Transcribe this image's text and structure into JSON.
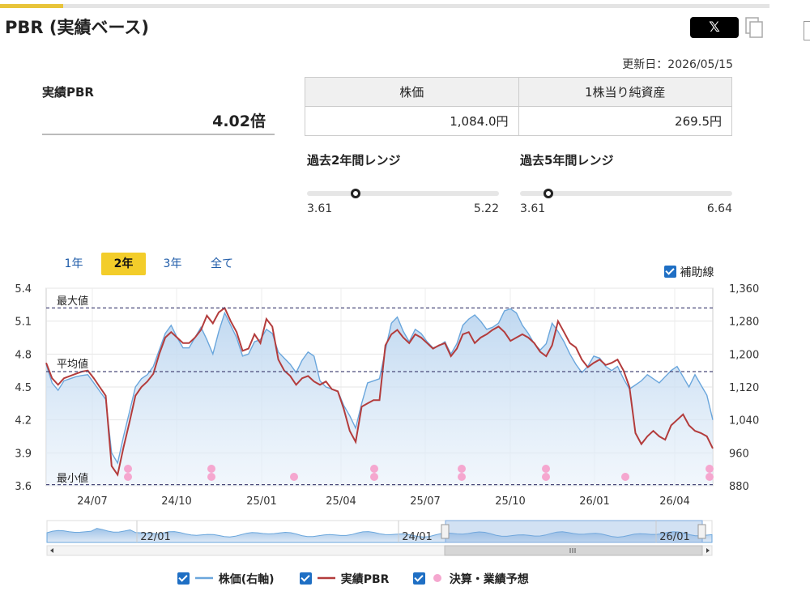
{
  "header": {
    "title": "PBR (実績ベース)",
    "share_label": "𝕏",
    "updated": "更新日：2026/05/15"
  },
  "pbr": {
    "label": "実績PBR",
    "value": "4.02倍"
  },
  "info_table": {
    "headers": [
      "株価",
      "1株当り純資産"
    ],
    "values": [
      "1,084.0円",
      "269.5円"
    ]
  },
  "ranges": [
    {
      "title": "過去2年間レンジ",
      "min": "3.61",
      "max": "5.22",
      "current": 4.02,
      "lo": 3.61,
      "hi": 5.22
    },
    {
      "title": "過去5年間レンジ",
      "min": "3.61",
      "max": "6.64",
      "current": 4.02,
      "lo": 3.61,
      "hi": 6.64
    }
  ],
  "tabs": [
    "1年",
    "2年",
    "3年",
    "全て"
  ],
  "active_tab": "2年",
  "aux_lines_label": "補助線",
  "legend": [
    "株価(右軸)",
    "実績PBR",
    "決算・業績予想"
  ],
  "colors": {
    "price": "#6aa6dc",
    "pbr": "#b33c3c",
    "event": "#f5a7cf",
    "accent": "#f3cd2a"
  },
  "chart_data": {
    "type": "line",
    "x_ticks": [
      "24/07",
      "24/10",
      "25/01",
      "25/04",
      "25/07",
      "25/10",
      "26/01",
      "26/04"
    ],
    "y_left": {
      "min": 3.6,
      "max": 5.4,
      "ticks": [
        "5.4",
        "5.1",
        "4.8",
        "4.5",
        "4.2",
        "3.9",
        "3.6"
      ]
    },
    "y_right": {
      "min": 880,
      "max": 1360,
      "ticks": [
        "1,360",
        "1,280",
        "1,200",
        "1,120",
        "1,040",
        "960",
        "880"
      ]
    },
    "ref_lines": [
      {
        "label": "最大値",
        "value": 5.22
      },
      {
        "label": "平均値",
        "value": 4.64
      },
      {
        "label": "最小値",
        "value": 3.61
      }
    ],
    "series": [
      {
        "name": "株価(右軸)",
        "axis": "right",
        "values": [
          1175,
          1130,
          1112,
          1135,
          1140,
          1145,
          1148,
          1150,
          1130,
          1110,
          1090,
          960,
          935,
          1000,
          1060,
          1120,
          1140,
          1150,
          1170,
          1210,
          1250,
          1270,
          1240,
          1215,
          1215,
          1240,
          1265,
          1235,
          1200,
          1255,
          1300,
          1270,
          1240,
          1195,
          1200,
          1230,
          1235,
          1260,
          1250,
          1205,
          1190,
          1175,
          1155,
          1185,
          1205,
          1195,
          1135,
          1120,
          1115,
          1110,
          1075,
          1050,
          1020,
          1080,
          1130,
          1135,
          1140,
          1210,
          1275,
          1290,
          1255,
          1230,
          1260,
          1250,
          1230,
          1215,
          1220,
          1230,
          1200,
          1225,
          1270,
          1285,
          1295,
          1280,
          1260,
          1265,
          1275,
          1305,
          1310,
          1300,
          1270,
          1250,
          1225,
          1210,
          1225,
          1275,
          1255,
          1230,
          1200,
          1175,
          1155,
          1170,
          1195,
          1190,
          1170,
          1160,
          1170,
          1140,
          1115,
          1125,
          1135,
          1150,
          1140,
          1130,
          1145,
          1160,
          1170,
          1145,
          1120,
          1150,
          1125,
          1100,
          1040
        ],
        "dates_start": "2024-05-15"
      },
      {
        "name": "実績PBR",
        "axis": "left",
        "values": [
          4.72,
          4.58,
          4.52,
          4.58,
          4.6,
          4.62,
          4.64,
          4.65,
          4.58,
          4.5,
          4.42,
          3.78,
          3.7,
          3.95,
          4.18,
          4.42,
          4.5,
          4.55,
          4.62,
          4.8,
          4.95,
          5.0,
          4.95,
          4.9,
          4.9,
          4.95,
          5.02,
          5.15,
          5.08,
          5.18,
          5.22,
          5.1,
          5.0,
          4.83,
          4.85,
          4.98,
          4.9,
          5.12,
          5.05,
          4.75,
          4.65,
          4.6,
          4.52,
          4.58,
          4.6,
          4.55,
          4.52,
          4.55,
          4.48,
          4.46,
          4.3,
          4.1,
          4.0,
          4.32,
          4.35,
          4.38,
          4.38,
          4.88,
          4.98,
          5.02,
          4.95,
          4.9,
          4.98,
          4.95,
          4.9,
          4.85,
          4.88,
          4.9,
          4.78,
          4.85,
          4.98,
          5.0,
          4.9,
          4.95,
          4.98,
          5.02,
          5.05,
          5.0,
          4.92,
          4.95,
          4.98,
          4.95,
          4.9,
          4.82,
          4.78,
          4.88,
          5.1,
          5.0,
          4.9,
          4.86,
          4.75,
          4.68,
          4.72,
          4.75,
          4.7,
          4.72,
          4.75,
          4.65,
          4.5,
          4.08,
          3.98,
          4.05,
          4.1,
          4.05,
          4.02,
          4.15,
          4.2,
          4.25,
          4.15,
          4.1,
          4.08,
          4.05,
          3.94
        ]
      },
      {
        "name": "決算・業績予想",
        "type": "scatter",
        "x": [
          "24/08",
          "24/11",
          "25/02",
          "25/05",
          "25/08",
          "25/11",
          "26/02",
          "26/05"
        ]
      }
    ],
    "navigator_ticks": [
      "22/01",
      "24/01",
      "26/01"
    ]
  }
}
